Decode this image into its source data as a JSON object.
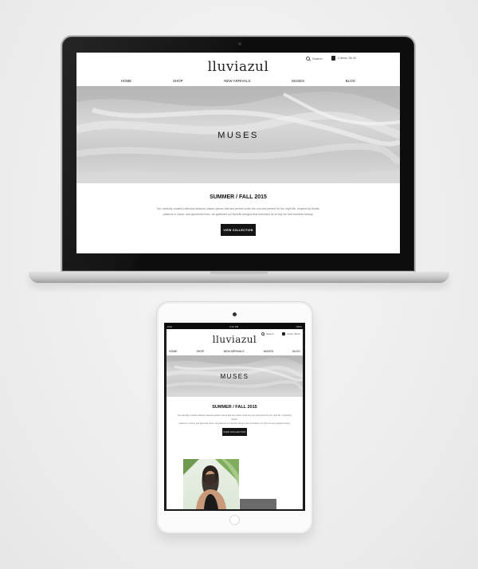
{
  "site": {
    "logo": "lluviazul",
    "search_label": "Search",
    "cart_label": "0 items / $0.00",
    "nav": [
      "HOME",
      "SHOP",
      "NEW ARRIVALS",
      "MUSES",
      "BLOG"
    ],
    "hero_title": "MUSES",
    "section_heading": "SUMMER / FALL 2015",
    "body_line_1": "Our carefully curated collection features classic pieces that are perfect under the sun and perfect for the night life. Inspired by florals,",
    "body_line_2": "patterns in colour, and geometric lines, we gathered our favorite designs that reminded us of why we love timeless beauty.",
    "cta_label": "VIEW COLLECTION"
  },
  "tablet_status": {
    "left": "iPad",
    "time": "2:44 PM",
    "right": "100%"
  },
  "icons": [
    "search-icon",
    "cart-icon",
    "camera",
    "home-button"
  ],
  "colors": {
    "background": "#f1f1f1",
    "cta_background": "#141414",
    "hero_grey": "#cfcfcf"
  }
}
